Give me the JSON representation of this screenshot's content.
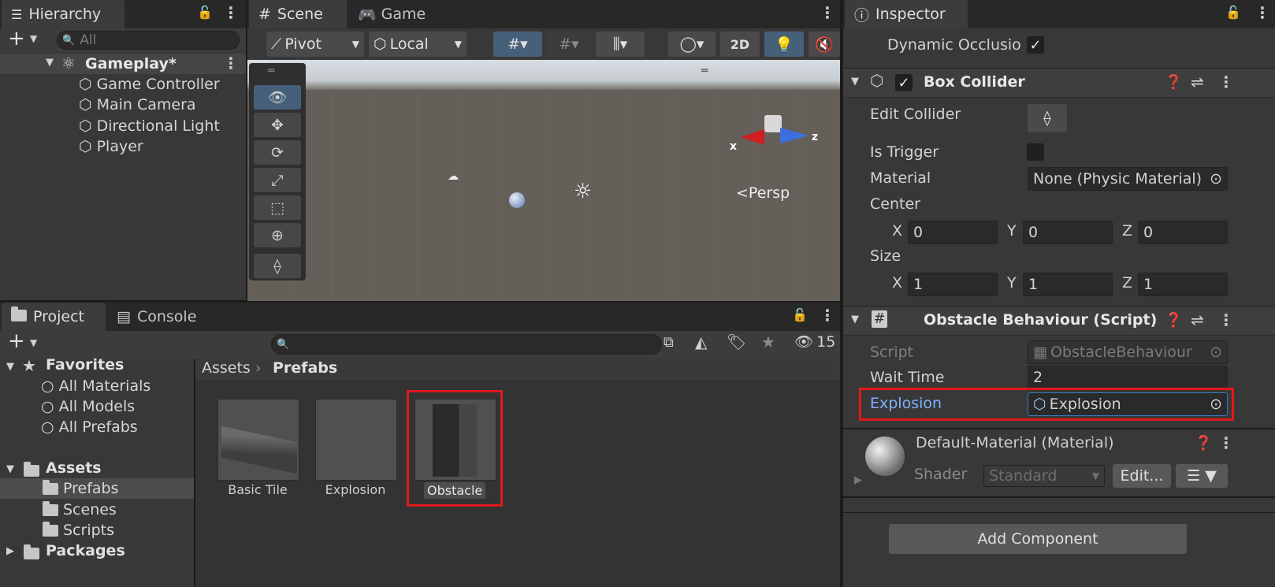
{
  "hierarchy": {
    "tab_label": "Hierarchy",
    "search_placeholder": "All",
    "scene_name": "Gameplay*",
    "items": [
      "Game Controller",
      "Main Camera",
      "Directional Light",
      "Player"
    ]
  },
  "scene_view": {
    "tabs": [
      "Scene",
      "Game"
    ],
    "pivot_label": "Pivot",
    "local_label": "Local",
    "mode_2d_label": "2D",
    "persp_label": "Persp",
    "gizmo_axes": {
      "x": "x",
      "z": "z"
    }
  },
  "project": {
    "tabs": [
      "Project",
      "Console"
    ],
    "hidden_count": "15",
    "favorites": {
      "label": "Favorites",
      "items": [
        "All Materials",
        "All Models",
        "All Prefabs"
      ]
    },
    "assets": {
      "label": "Assets",
      "items": [
        "Prefabs",
        "Scenes",
        "Scripts"
      ]
    },
    "packages_label": "Packages",
    "breadcrumb": {
      "root": "Assets",
      "current": "Prefabs"
    },
    "prefabs": [
      "Basic Tile",
      "Explosion",
      "Obstacle"
    ]
  },
  "inspector": {
    "tab_label": "Inspector",
    "dynamic_occlusion_label": "Dynamic Occlusio",
    "box_collider": {
      "title": "Box Collider",
      "edit_collider_label": "Edit Collider",
      "is_trigger_label": "Is Trigger",
      "material_label": "Material",
      "material_value": "None (Physic Material)",
      "center_label": "Center",
      "center": {
        "x": "0",
        "y": "0",
        "z": "0"
      },
      "size_label": "Size",
      "size": {
        "x": "1",
        "y": "1",
        "z": "1"
      },
      "axis_labels": {
        "x": "X",
        "y": "Y",
        "z": "Z"
      }
    },
    "obstacle_behaviour": {
      "title": "Obstacle Behaviour (Script)",
      "script_label": "Script",
      "script_value": "ObstacleBehaviour",
      "wait_time_label": "Wait Time",
      "wait_time_value": "2",
      "explosion_label": "Explosion",
      "explosion_value": "Explosion"
    },
    "material": {
      "title": "Default-Material (Material)",
      "shader_label": "Shader",
      "shader_value": "Standard",
      "edit_label": "Edit..."
    },
    "add_component_label": "Add Component"
  },
  "colors": {
    "highlight_red": "#e0191e",
    "selected_blue": "#2c5d87",
    "link_blue": "#7fb0ff"
  }
}
